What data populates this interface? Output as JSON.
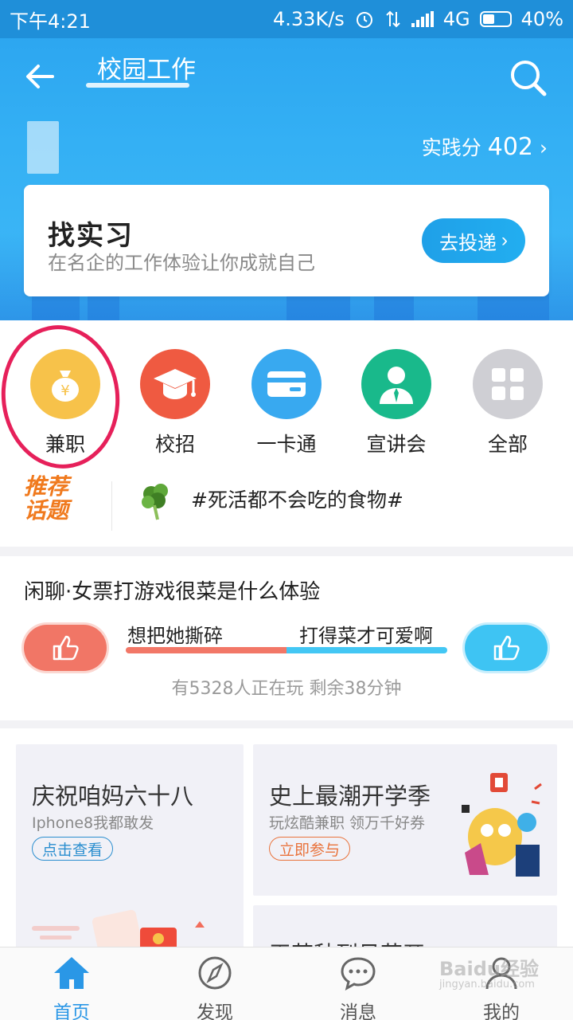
{
  "status_bar": {
    "time": "下午4:21",
    "speed": "4.33K/s",
    "network": "4G",
    "battery": "40%"
  },
  "nav": {
    "title": "校园工作",
    "back_icon": "back-arrow-icon",
    "search_icon": "search-icon"
  },
  "profile": {
    "score_label": "实践分",
    "score_value": "402",
    "chevron": "›"
  },
  "intern_card": {
    "title": "找实习",
    "subtitle": "在名企的工作体验让你成就自己",
    "button_label": "去投递",
    "button_chevron": "›"
  },
  "quick_entries": [
    {
      "label": "兼职",
      "icon": "money-bag-icon",
      "color": "#f7c24a"
    },
    {
      "label": "校招",
      "icon": "graduation-cap-icon",
      "color": "#ef5a41"
    },
    {
      "label": "一卡通",
      "icon": "card-icon",
      "color": "#38a9f0"
    },
    {
      "label": "宣讲会",
      "icon": "speaker-person-icon",
      "color": "#19b98b"
    },
    {
      "label": "全部",
      "icon": "grid-icon",
      "color": "#cfcfd4"
    }
  ],
  "topic": {
    "badge_line1": "推荐",
    "badge_line2": "话题",
    "text": "#死活都不会吃的食物#"
  },
  "vote": {
    "title": "闲聊·女票打游戏很菜是什么体验",
    "left_option": "想把她撕碎",
    "right_option": "打得菜才可爱啊",
    "split": 0.5,
    "meta": "有5328人正在玩 剩余38分钟"
  },
  "promos": [
    {
      "title": "庆祝咱妈六十八",
      "subtitle": "Iphone8我都敢发",
      "button": "点击查看"
    },
    {
      "title": "史上最潮开学季",
      "subtitle": "玩炫酷兼职 领万千好券",
      "button": "立即参与"
    },
    {
      "title": "天若秋到见花开"
    }
  ],
  "tabs": [
    {
      "label": "首页",
      "icon": "home-icon",
      "active": true
    },
    {
      "label": "发现",
      "icon": "compass-icon",
      "active": false
    },
    {
      "label": "消息",
      "icon": "chat-bubble-icon",
      "active": false
    },
    {
      "label": "我的",
      "icon": "person-icon",
      "active": false
    }
  ],
  "watermark": {
    "text": "Baidu经验",
    "sub": "jingyan.baidu.com"
  },
  "colors": {
    "primary": "#2aa3ef",
    "accent_red": "#f17666",
    "accent_blue": "#3ec4f3",
    "annotation": "#e6205a"
  }
}
